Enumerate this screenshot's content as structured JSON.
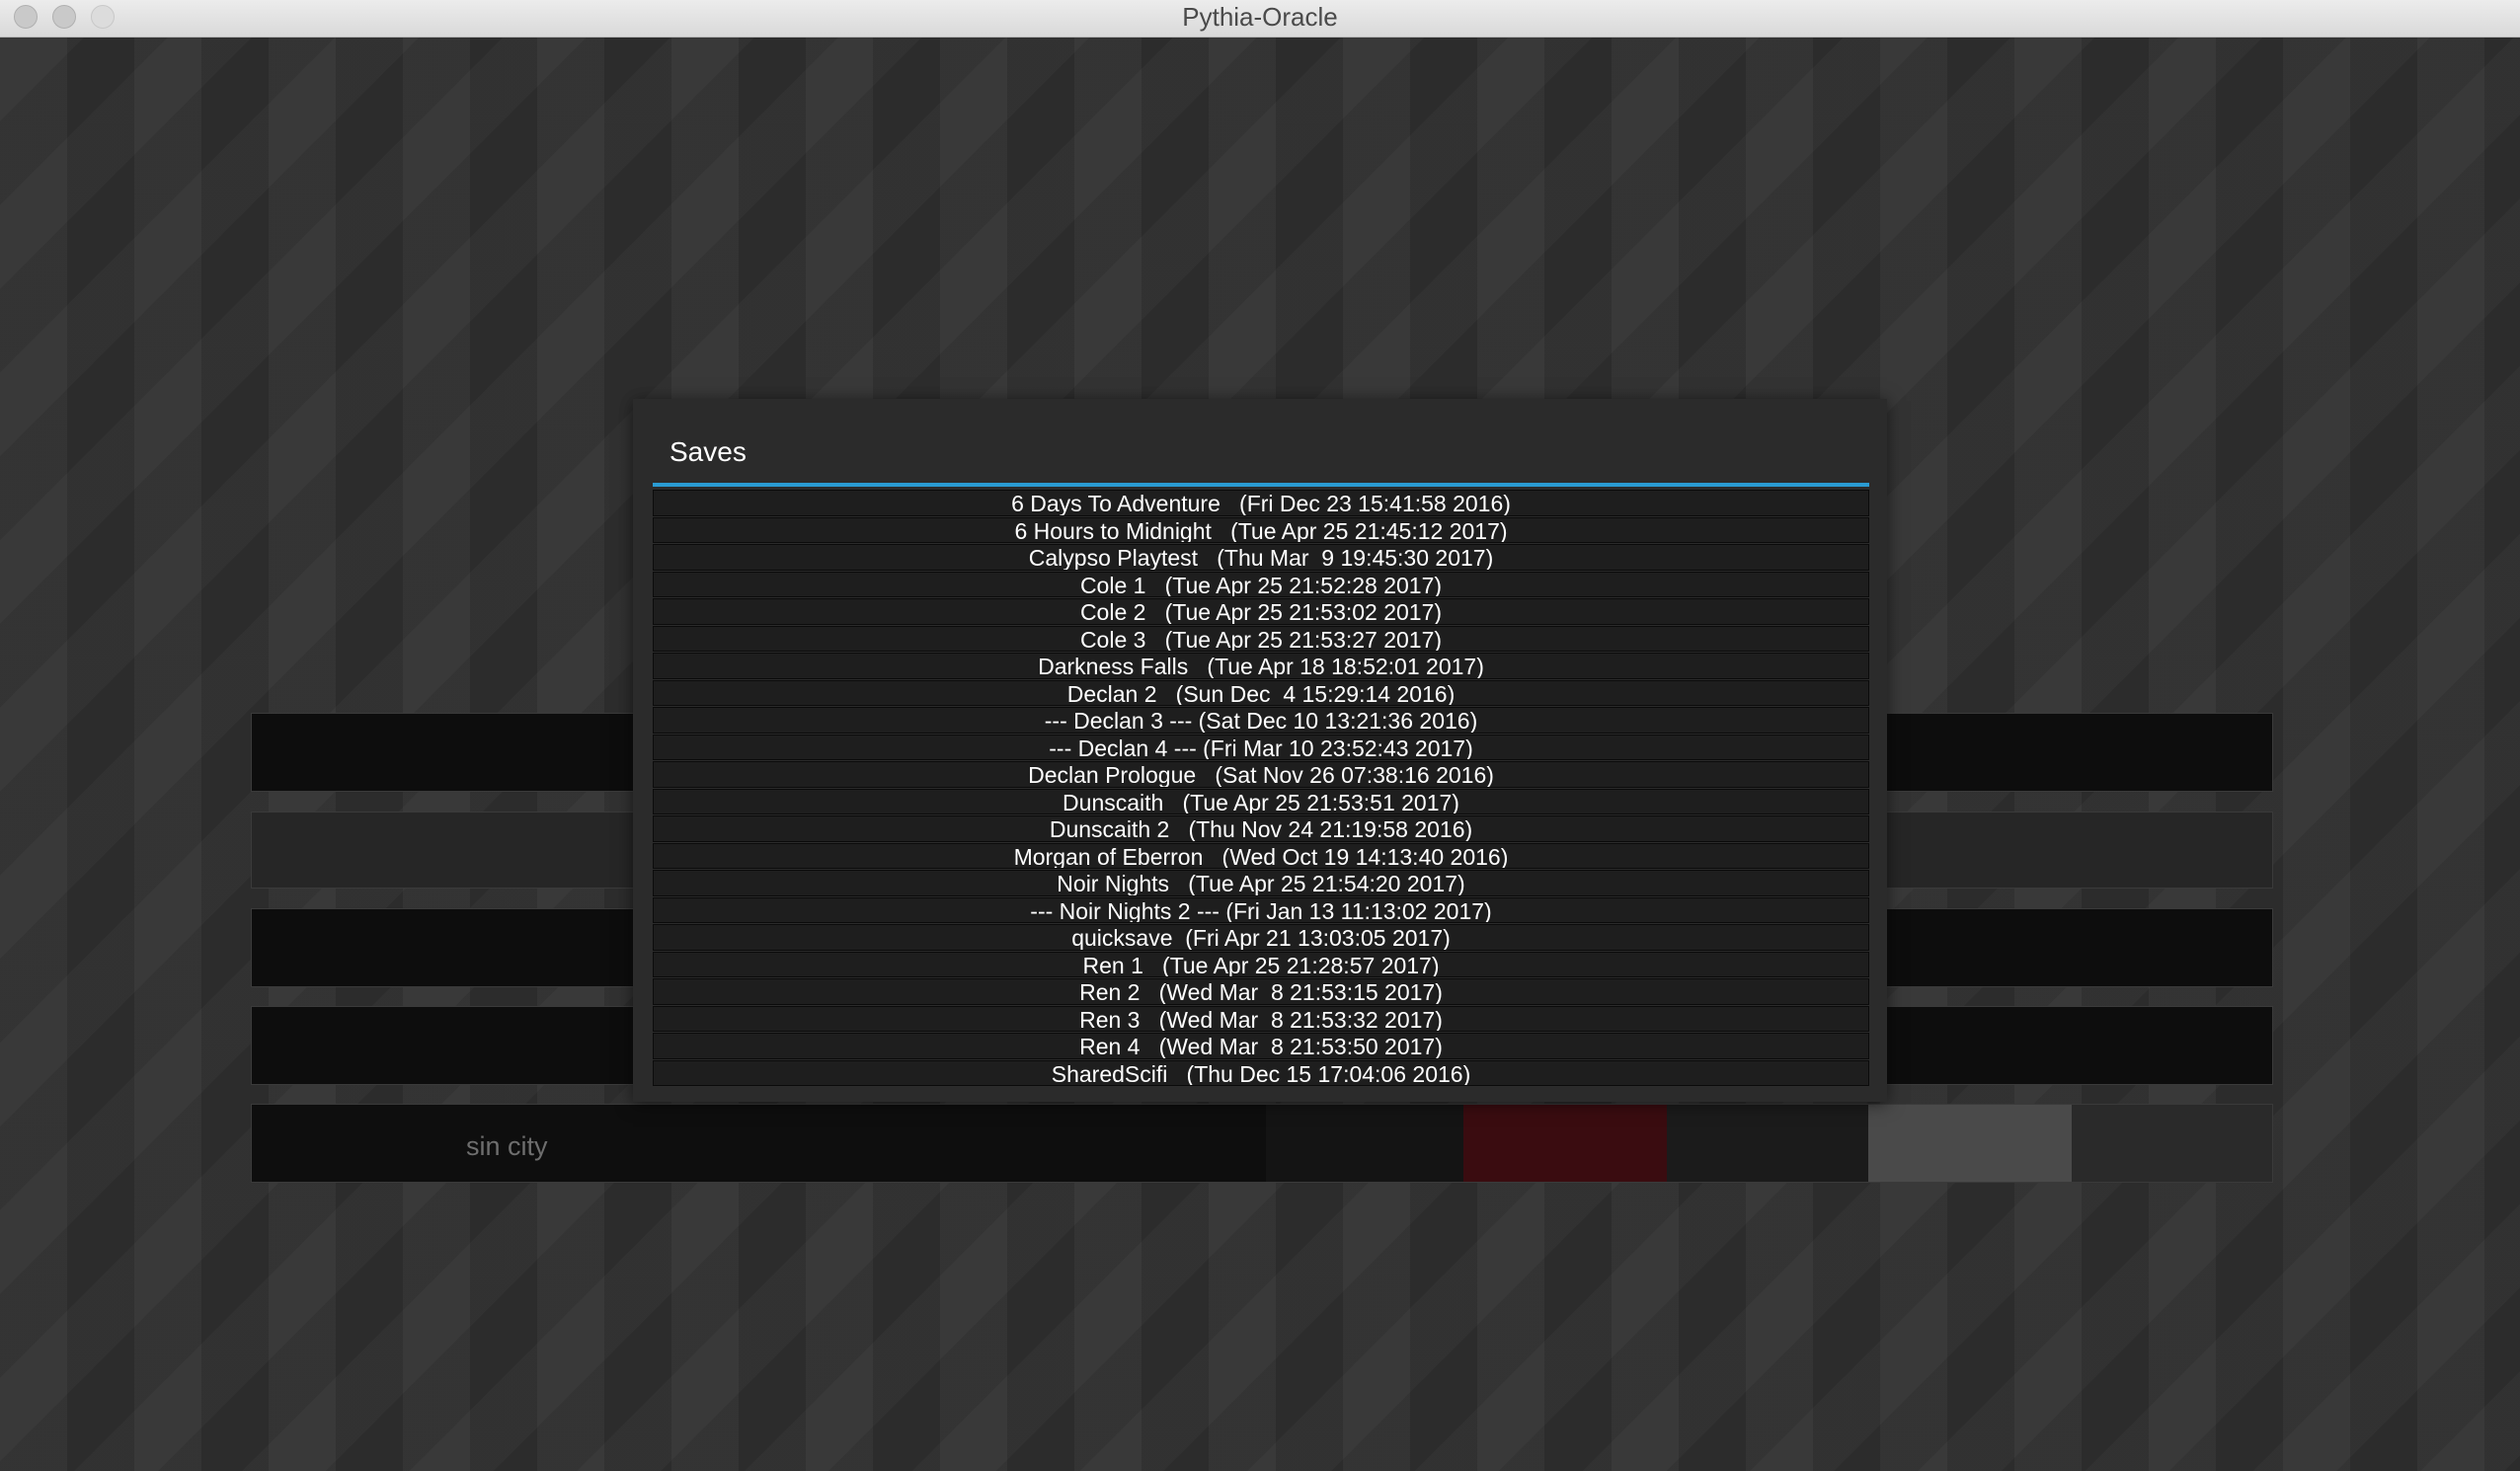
{
  "window": {
    "title": "Pythia-Oracle"
  },
  "background": {
    "campaign_label": "sin city"
  },
  "dialog": {
    "title": "Saves",
    "accent_color": "#2a9bd2",
    "saves": [
      "6 Days To Adventure   (Fri Dec 23 15:41:58 2016)",
      "6 Hours to Midnight   (Tue Apr 25 21:45:12 2017)",
      "Calypso Playtest   (Thu Mar  9 19:45:30 2017)",
      "Cole 1   (Tue Apr 25 21:52:28 2017)",
      "Cole 2   (Tue Apr 25 21:53:02 2017)",
      "Cole 3   (Tue Apr 25 21:53:27 2017)",
      "Darkness Falls   (Tue Apr 18 18:52:01 2017)",
      "Declan 2   (Sun Dec  4 15:29:14 2016)",
      "--- Declan 3 --- (Sat Dec 10 13:21:36 2016)",
      "--- Declan 4 --- (Fri Mar 10 23:52:43 2017)",
      "Declan Prologue   (Sat Nov 26 07:38:16 2016)",
      "Dunscaith   (Tue Apr 25 21:53:51 2017)",
      "Dunscaith 2   (Thu Nov 24 21:19:58 2016)",
      "Morgan of Eberron   (Wed Oct 19 14:13:40 2016)",
      "Noir Nights   (Tue Apr 25 21:54:20 2017)",
      "--- Noir Nights 2 --- (Fri Jan 13 11:13:02 2017)",
      "quicksave  (Fri Apr 21 13:03:05 2017)",
      "Ren 1   (Tue Apr 25 21:28:57 2017)",
      "Ren 2   (Wed Mar  8 21:53:15 2017)",
      "Ren 3   (Wed Mar  8 21:53:32 2017)",
      "Ren 4   (Wed Mar  8 21:53:50 2017)",
      "SharedScifi   (Thu Dec 15 17:04:06 2016)"
    ]
  }
}
